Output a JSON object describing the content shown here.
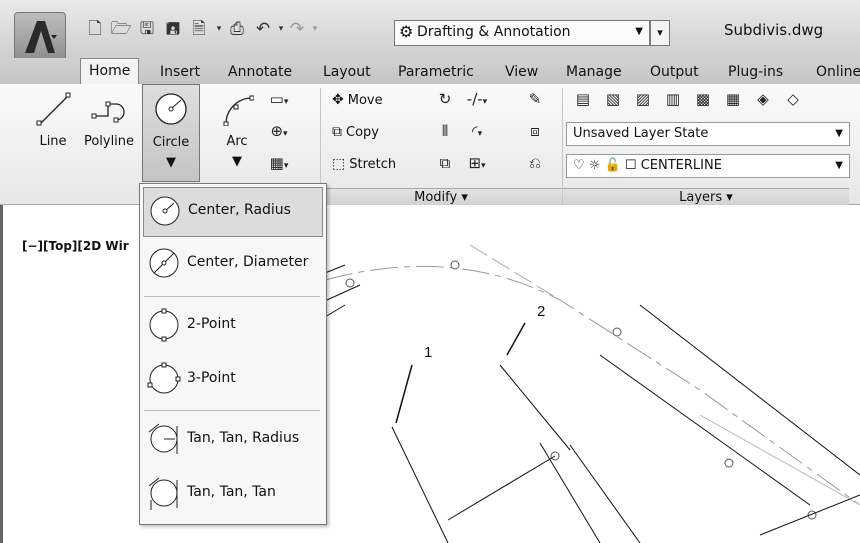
{
  "title_bar": {
    "workspace": "Drafting & Annotation",
    "document_title": "Subdivis.dwg"
  },
  "tabs": [
    "Home",
    "Insert",
    "Annotate",
    "Layout",
    "Parametric",
    "View",
    "Manage",
    "Output",
    "Plug-ins",
    "Online"
  ],
  "draw_panel": {
    "line": "Line",
    "polyline": "Polyline",
    "circle": "Circle",
    "arc": "Arc"
  },
  "modify_panel": {
    "move": "Move",
    "copy": "Copy",
    "stretch": "Stretch",
    "title": "Modify ▾"
  },
  "layers_panel": {
    "layer_state": "Unsaved Layer State",
    "current_layer": "CENTERLINE",
    "title": "Layers ▾"
  },
  "viewport": {
    "label": "[−][Top][2D Wir"
  },
  "circle_menu": {
    "items": [
      "Center, Radius",
      "Center, Diameter",
      "2-Point",
      "3-Point",
      "Tan, Tan, Radius",
      "Tan, Tan, Tan"
    ]
  },
  "callouts": [
    "1",
    "2"
  ]
}
